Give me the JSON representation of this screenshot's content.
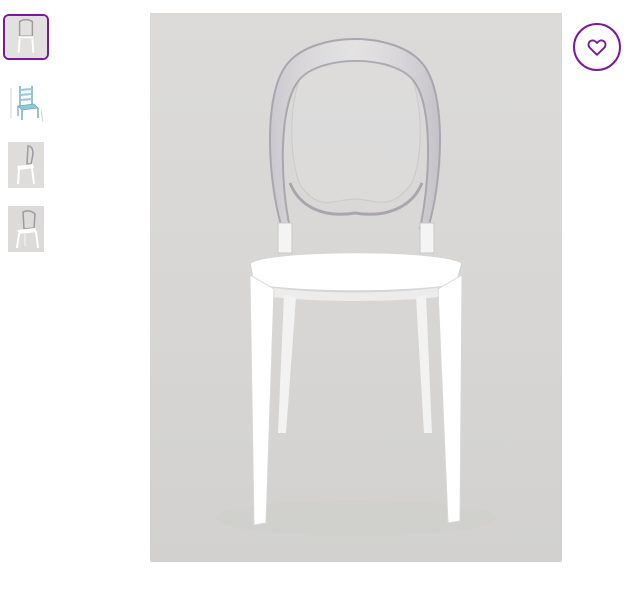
{
  "gallery": {
    "thumbnails": [
      {
        "icon": "clear-chair-front-thumbnail",
        "selected": true
      },
      {
        "icon": "blue-chair-diagram-thumbnail",
        "selected": false
      },
      {
        "icon": "chair-side-view-thumbnail",
        "selected": false
      },
      {
        "icon": "chair-angle-view-thumbnail",
        "selected": false
      }
    ],
    "main_image_icon": "clear-back-white-chair-photo"
  },
  "favorite": {
    "icon": "heart-icon",
    "accent_color": "#7b189f"
  }
}
